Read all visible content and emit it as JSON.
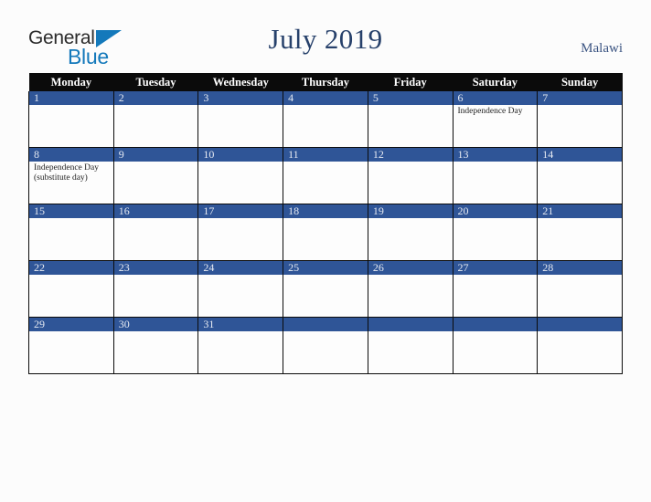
{
  "brand": {
    "name_part1": "General",
    "name_part2": "Blue",
    "triangle_icon": "triangle-icon",
    "color_dark": "#2b2b2b",
    "color_blue": "#1479bb"
  },
  "header": {
    "title": "July 2019",
    "country": "Malawi",
    "title_color": "#27416b",
    "country_color": "#3b5482"
  },
  "calendar": {
    "accent_color": "#2f5597",
    "header_bg": "#0b0b0b",
    "weekdays": [
      "Monday",
      "Tuesday",
      "Wednesday",
      "Thursday",
      "Friday",
      "Saturday",
      "Sunday"
    ],
    "weeks": [
      [
        {
          "day": "1",
          "events": []
        },
        {
          "day": "2",
          "events": []
        },
        {
          "day": "3",
          "events": []
        },
        {
          "day": "4",
          "events": []
        },
        {
          "day": "5",
          "events": []
        },
        {
          "day": "6",
          "events": [
            "Independence Day"
          ]
        },
        {
          "day": "7",
          "events": []
        }
      ],
      [
        {
          "day": "8",
          "events": [
            "Independence Day (substitute day)"
          ]
        },
        {
          "day": "9",
          "events": []
        },
        {
          "day": "10",
          "events": []
        },
        {
          "day": "11",
          "events": []
        },
        {
          "day": "12",
          "events": []
        },
        {
          "day": "13",
          "events": []
        },
        {
          "day": "14",
          "events": []
        }
      ],
      [
        {
          "day": "15",
          "events": []
        },
        {
          "day": "16",
          "events": []
        },
        {
          "day": "17",
          "events": []
        },
        {
          "day": "18",
          "events": []
        },
        {
          "day": "19",
          "events": []
        },
        {
          "day": "20",
          "events": []
        },
        {
          "day": "21",
          "events": []
        }
      ],
      [
        {
          "day": "22",
          "events": []
        },
        {
          "day": "23",
          "events": []
        },
        {
          "day": "24",
          "events": []
        },
        {
          "day": "25",
          "events": []
        },
        {
          "day": "26",
          "events": []
        },
        {
          "day": "27",
          "events": []
        },
        {
          "day": "28",
          "events": []
        }
      ],
      [
        {
          "day": "29",
          "events": []
        },
        {
          "day": "30",
          "events": []
        },
        {
          "day": "31",
          "events": []
        },
        {
          "day": "",
          "events": []
        },
        {
          "day": "",
          "events": []
        },
        {
          "day": "",
          "events": []
        },
        {
          "day": "",
          "events": []
        }
      ]
    ]
  }
}
